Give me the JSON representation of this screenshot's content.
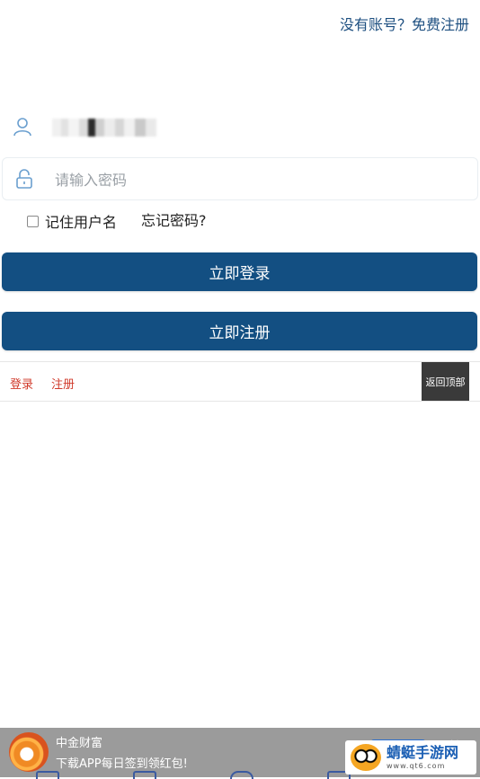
{
  "header": {
    "register_prompt": "没有账号？免费注册"
  },
  "form": {
    "username_icon": "user-icon",
    "password_icon": "lock-icon",
    "password_placeholder": "请输入密码",
    "remember_label": "记住用户名",
    "forgot_label": "忘记密码?",
    "login_button": "立即登录",
    "register_button": "立即注册"
  },
  "footer": {
    "login_link": "登录",
    "register_link": "注册",
    "back_to_top": "返回顶部"
  },
  "ad": {
    "title": "中金财富",
    "subtitle": "下载APP每日签到领红包!",
    "close": "×"
  },
  "watermark": {
    "brand": "蜻蜓手游网",
    "url": "www.qt6.com"
  },
  "colors": {
    "primary_button": "#134f82",
    "link_red": "#d03a2b",
    "top_link": "#1d4f80"
  }
}
